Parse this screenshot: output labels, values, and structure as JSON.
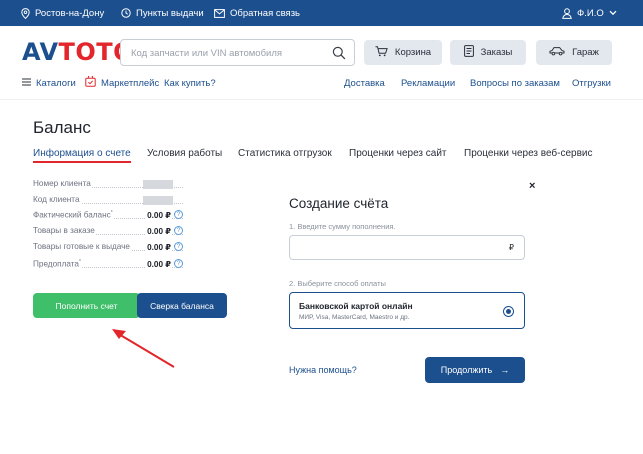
{
  "topbar": {
    "city": "Ростов-на-Дону",
    "pickup": "Пункты выдачи",
    "feedback": "Обратная связь",
    "user": "Ф.И.О",
    "icons": [
      "location-pin-icon",
      "clock-icon",
      "mail-icon",
      "user-icon",
      "chevron-down-icon"
    ]
  },
  "logo": {
    "part1": "AV",
    "part2": "TOTO"
  },
  "search": {
    "placeholder": "Код запчасти или VIN автомобиля",
    "value": ""
  },
  "header_buttons": {
    "cart": "Корзина",
    "orders": "Заказы",
    "garage": "Гараж"
  },
  "nav": {
    "catalogs": "Каталоги",
    "marketplace": "Маркетплейс",
    "how_to_buy": "Как купить?",
    "delivery": "Доставка",
    "claims": "Рекламации",
    "order_questions": "Вопросы по заказам",
    "shipments": "Отгрузки"
  },
  "page": {
    "title": "Баланс",
    "tabs": [
      {
        "label": "Информация о счете",
        "active": true
      },
      {
        "label": "Условия работы"
      },
      {
        "label": "Статистика отгрузок"
      },
      {
        "label": "Проценки через сайт"
      },
      {
        "label": "Проценки через веб-сервис"
      }
    ]
  },
  "info": {
    "client_number_label": "Номер клиента",
    "client_code_label": "Код клиента",
    "actual_balance_label": "Фактический баланс",
    "actual_balance_mark": "*",
    "actual_balance_value": "0.00 ₽",
    "goods_in_order_label": "Товары в заказе",
    "goods_in_order_value": "0.00 ₽",
    "goods_ready_label": "Товары готовые к выдаче",
    "goods_ready_value": "0.00 ₽",
    "prepayment_label": "Предоплата",
    "prepayment_mark": "*",
    "prepayment_value": "0.00 ₽",
    "help_glyph": "?"
  },
  "buttons": {
    "top_up": "Пополнить счет",
    "reconcile": "Сверка баланса"
  },
  "modal": {
    "close_glyph": "×",
    "title": "Создание счёта",
    "step1": "1. Введите сумму пополнения.",
    "amount_value": "",
    "currency": "₽",
    "step2": "2. Выберите способ оплаты",
    "option_title": "Банковской картой онлайн",
    "option_subtitle": "МИР, Visa, MasterCard, Maestro и др.",
    "option_selected": true,
    "help": "Нужна помощь?",
    "next": "Продолжить",
    "next_glyph": "→"
  },
  "colors": {
    "brand_blue": "#1c4f8d",
    "accent_red": "#e2262b",
    "green": "#3fbf6a",
    "button_gray": "#e3e8ef"
  }
}
